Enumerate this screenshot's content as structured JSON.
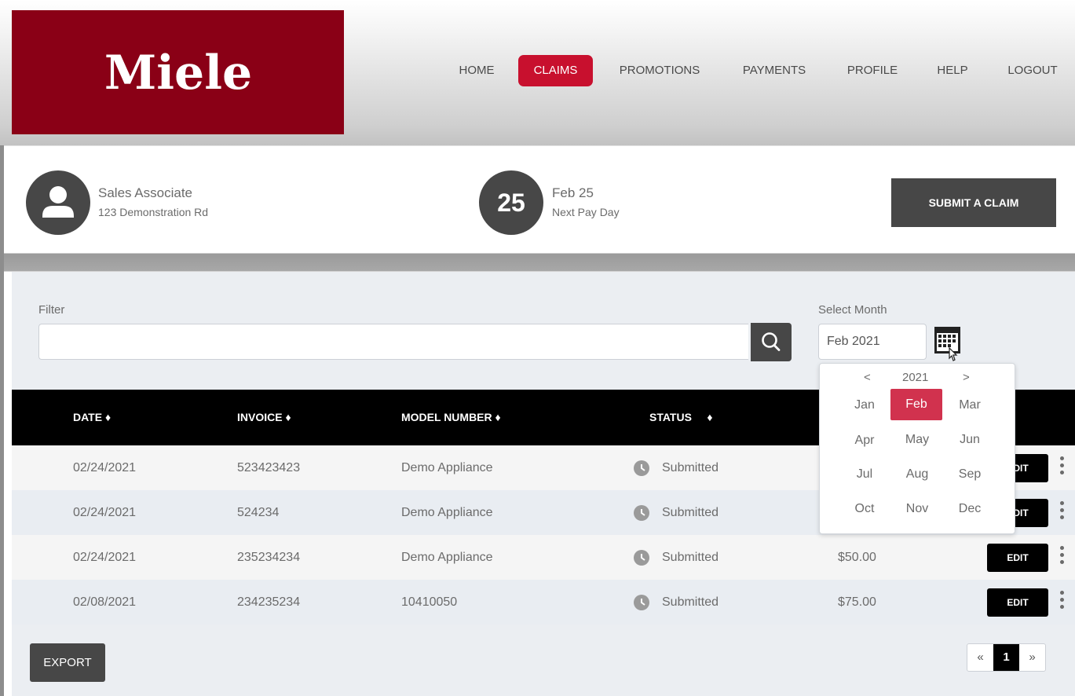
{
  "brand": {
    "logo_text": "Miele"
  },
  "nav": {
    "items": [
      "HOME",
      "CLAIMS",
      "PROMOTIONS",
      "PAYMENTS",
      "PROFILE",
      "HELP",
      "LOGOUT"
    ],
    "active": "CLAIMS"
  },
  "profile": {
    "name": "Sales Associate",
    "address": "123 Demonstration Rd",
    "pay_day_number": "25",
    "pay_date": "Feb 25",
    "pay_label": "Next Pay Day",
    "submit_label": "SUBMIT A CLAIM"
  },
  "filter": {
    "label": "Filter",
    "value": ""
  },
  "month": {
    "label": "Select Month",
    "value": "Feb 2021"
  },
  "picker": {
    "prev": "<",
    "year": "2021",
    "next": ">",
    "months": [
      "Jan",
      "Feb",
      "Mar",
      "Apr",
      "May",
      "Jun",
      "Jul",
      "Aug",
      "Sep",
      "Oct",
      "Nov",
      "Dec"
    ],
    "selected": "Feb"
  },
  "table": {
    "headers": [
      "DATE",
      "INVOICE",
      "MODEL NUMBER",
      "STATUS"
    ],
    "sort_glyph": "♦",
    "rows": [
      {
        "date": "02/24/2021",
        "invoice": "523423423",
        "model": "Demo Appliance",
        "status": "Submitted",
        "amount": "",
        "edit": "EDIT"
      },
      {
        "date": "02/24/2021",
        "invoice": "524234",
        "model": "Demo Appliance",
        "status": "Submitted",
        "amount": "",
        "edit": "EDIT"
      },
      {
        "date": "02/24/2021",
        "invoice": "235234234",
        "model": "Demo Appliance",
        "status": "Submitted",
        "amount": "$50.00",
        "edit": "EDIT"
      },
      {
        "date": "02/08/2021",
        "invoice": "234235234",
        "model": "10410050",
        "status": "Submitted",
        "amount": "$75.00",
        "edit": "EDIT"
      }
    ]
  },
  "export_label": "EXPORT",
  "pagination": {
    "first": "«",
    "current": "1",
    "last": "»"
  },
  "colors": {
    "brand_red": "#8a0016",
    "accent_red": "#c8102e",
    "dark": "#474747"
  }
}
